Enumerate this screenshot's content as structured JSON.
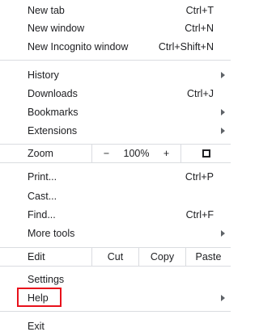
{
  "menu": {
    "new_tab": {
      "label": "New tab",
      "shortcut": "Ctrl+T"
    },
    "new_window": {
      "label": "New window",
      "shortcut": "Ctrl+N"
    },
    "new_incognito": {
      "label": "New Incognito window",
      "shortcut": "Ctrl+Shift+N"
    },
    "history": {
      "label": "History"
    },
    "downloads": {
      "label": "Downloads",
      "shortcut": "Ctrl+J"
    },
    "bookmarks": {
      "label": "Bookmarks"
    },
    "extensions": {
      "label": "Extensions"
    },
    "zoom": {
      "label": "Zoom",
      "minus": "−",
      "value": "100%",
      "plus": "+",
      "fullscreen_icon": "fullscreen-icon"
    },
    "print": {
      "label": "Print...",
      "shortcut": "Ctrl+P"
    },
    "cast": {
      "label": "Cast..."
    },
    "find": {
      "label": "Find...",
      "shortcut": "Ctrl+F"
    },
    "more_tools": {
      "label": "More tools"
    },
    "edit": {
      "label": "Edit",
      "cut": "Cut",
      "copy": "Copy",
      "paste": "Paste"
    },
    "settings": {
      "label": "Settings"
    },
    "help": {
      "label": "Help"
    },
    "exit": {
      "label": "Exit"
    }
  },
  "colors": {
    "highlight": "#e8111b",
    "separator": "#dadce0",
    "text": "#202124"
  }
}
